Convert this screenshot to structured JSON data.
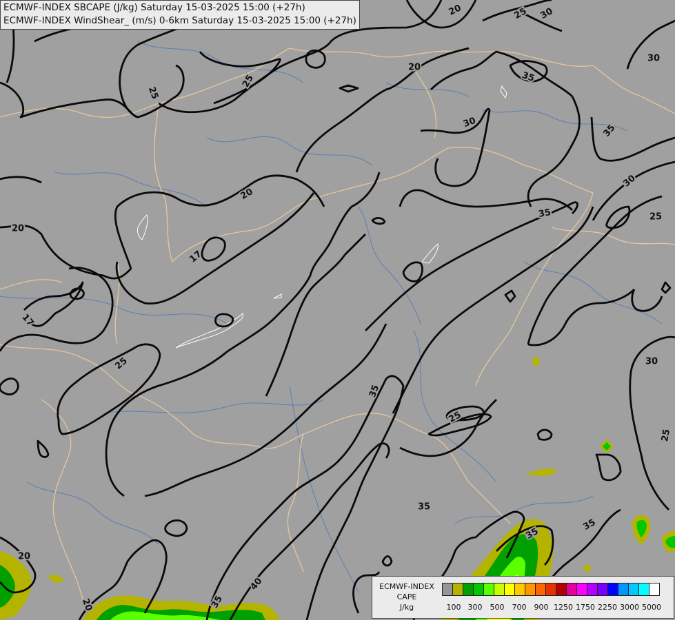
{
  "header": {
    "line1": "ECMWF-INDEX SBCAPE (J/kg) Saturday 15-03-2025 15:00 (+27h)",
    "line2": "ECMWF-INDEX WindShear_ (m/s) 0-6km Saturday 15-03-2025 15:00 (+27h)"
  },
  "colors": {
    "background": "#a0a0a0",
    "contour": "#0a0a0a",
    "border": "#e6c79b",
    "river": "#5a7fb5",
    "lake": "#ffffff"
  },
  "legend": {
    "title_lines": [
      "ECMWF-INDEX",
      "CAPE",
      "J/kg"
    ],
    "swatches": [
      "#969696",
      "#b4b400",
      "#00a000",
      "#00c800",
      "#5aff00",
      "#c8ff00",
      "#ffff00",
      "#ffc800",
      "#ff9600",
      "#ff6400",
      "#e63200",
      "#b40000",
      "#e6009b",
      "#ff00ff",
      "#b400ff",
      "#7800ff",
      "#0000ff",
      "#0096ff",
      "#00c8ff",
      "#00ffff",
      "#ffffff"
    ],
    "ticks": [
      "100",
      "300",
      "500",
      "700",
      "900",
      "1250",
      "1750",
      "2250",
      "3000",
      "5000"
    ]
  },
  "contour_labels": [
    {
      "text": "20"
    },
    {
      "text": "25"
    },
    {
      "text": "30"
    },
    {
      "text": "30"
    },
    {
      "text": "35"
    },
    {
      "text": "20"
    },
    {
      "text": "25"
    },
    {
      "text": "25"
    },
    {
      "text": "30"
    },
    {
      "text": "35"
    },
    {
      "text": "20"
    },
    {
      "text": "30"
    },
    {
      "text": "35"
    },
    {
      "text": "20"
    },
    {
      "text": "17"
    },
    {
      "text": "17"
    },
    {
      "text": "25"
    },
    {
      "text": "25"
    },
    {
      "text": "35"
    },
    {
      "text": "25"
    },
    {
      "text": "30"
    },
    {
      "text": "25"
    },
    {
      "text": "35"
    },
    {
      "text": "35"
    },
    {
      "text": "35"
    },
    {
      "text": "20"
    },
    {
      "text": "35"
    },
    {
      "text": "40"
    },
    {
      "text": "20"
    }
  ]
}
